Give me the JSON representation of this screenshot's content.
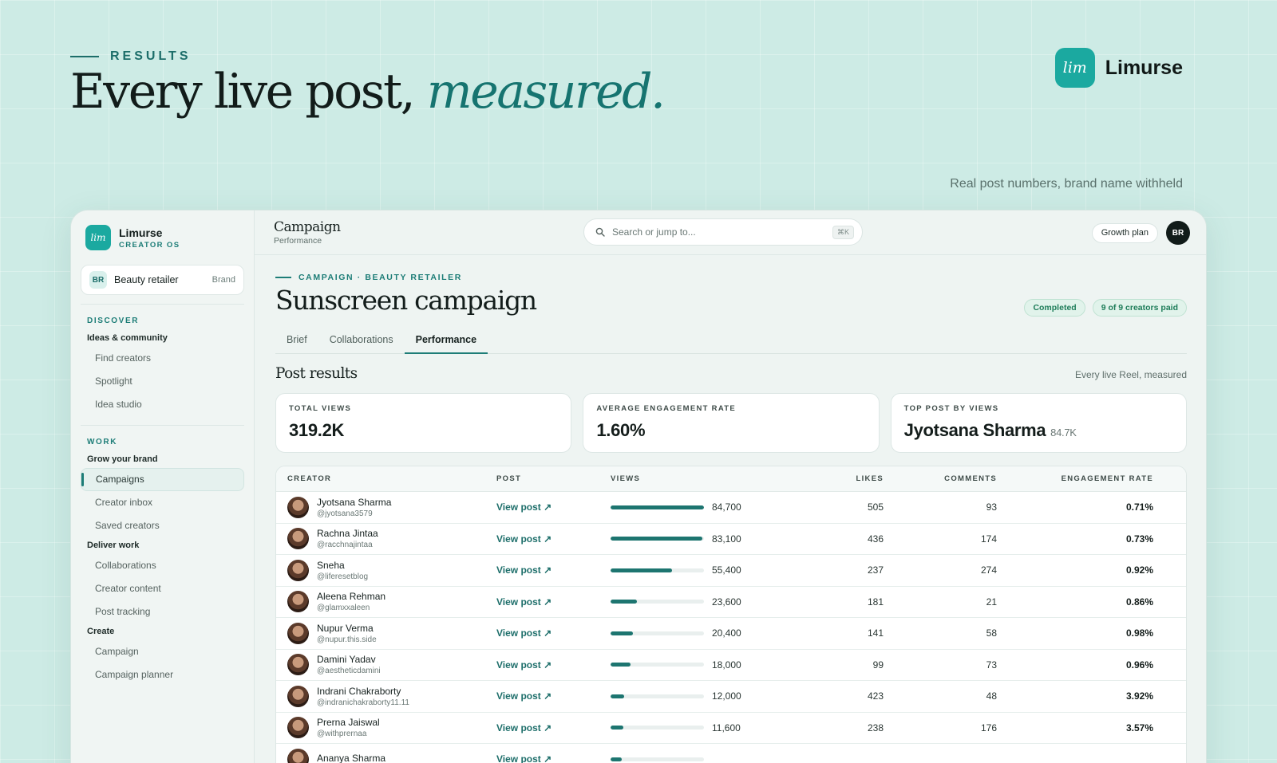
{
  "hero": {
    "eyebrow": "RESULTS",
    "headline_main": "Every live post, ",
    "headline_accent": "measured.",
    "brand_name": "Limurse",
    "logo_text": "lim",
    "caption": "Real post numbers, brand name withheld"
  },
  "colors": {
    "accent": "#1d7570",
    "logo": "#1ba9a0",
    "background": "#cdebe5"
  },
  "sidebar": {
    "brand_name": "Limurse",
    "brand_tag": "CREATOR OS",
    "logo_text": "lim",
    "account": {
      "initials": "BR",
      "name": "Beauty retailer",
      "tag": "Brand"
    },
    "discover_label": "DISCOVER",
    "ideas_group": "Ideas & community",
    "ideas_items": [
      "Find creators",
      "Spotlight",
      "Idea studio"
    ],
    "work_label": "WORK",
    "grow_group": "Grow your brand",
    "grow_items": [
      "Campaigns",
      "Creator inbox",
      "Saved creators"
    ],
    "deliver_group": "Deliver work",
    "deliver_items": [
      "Collaborations",
      "Creator content",
      "Post tracking"
    ],
    "create_group": "Create",
    "create_items": [
      "Campaign",
      "Campaign planner"
    ]
  },
  "topbar": {
    "title": "Campaign",
    "subtitle": "Performance",
    "search_placeholder": "Search or jump to...",
    "shortcut": "⌘K",
    "plan": "Growth plan",
    "user_initials": "BR"
  },
  "campaign": {
    "breadcrumb": "CAMPAIGN · BEAUTY RETAILER",
    "title": "Sunscreen campaign",
    "status": "Completed",
    "paid": "9 of 9 creators paid",
    "tabs": [
      "Brief",
      "Collaborations",
      "Performance"
    ],
    "active_tab": "Performance"
  },
  "results": {
    "title": "Post results",
    "note": "Every live Reel, measured",
    "stats": [
      {
        "label": "TOTAL VIEWS",
        "value": "319.2K",
        "sub": ""
      },
      {
        "label": "AVERAGE ENGAGEMENT RATE",
        "value": "1.60%",
        "sub": ""
      },
      {
        "label": "TOP POST BY VIEWS",
        "value": "Jyotsana Sharma",
        "sub": "84.7K"
      }
    ]
  },
  "table": {
    "columns": [
      "CREATOR",
      "POST",
      "VIEWS",
      "LIKES",
      "COMMENTS",
      "ENGAGEMENT RATE"
    ],
    "link_label": "View post ↗",
    "max_views": 84700,
    "rows": [
      {
        "name": "Jyotsana Sharma",
        "handle": "@jyotsana3579",
        "views": 84700,
        "views_text": "84,700",
        "likes": "505",
        "comments": "93",
        "er": "0.71%"
      },
      {
        "name": "Rachna Jintaa",
        "handle": "@racchnajintaa",
        "views": 83100,
        "views_text": "83,100",
        "likes": "436",
        "comments": "174",
        "er": "0.73%"
      },
      {
        "name": "Sneha",
        "handle": "@liferesetblog",
        "views": 55400,
        "views_text": "55,400",
        "likes": "237",
        "comments": "274",
        "er": "0.92%"
      },
      {
        "name": "Aleena Rehman",
        "handle": "@glamxxaleen",
        "views": 23600,
        "views_text": "23,600",
        "likes": "181",
        "comments": "21",
        "er": "0.86%"
      },
      {
        "name": "Nupur Verma",
        "handle": "@nupur.this.side",
        "views": 20400,
        "views_text": "20,400",
        "likes": "141",
        "comments": "58",
        "er": "0.98%"
      },
      {
        "name": "Damini Yadav",
        "handle": "@aestheticdamini",
        "views": 18000,
        "views_text": "18,000",
        "likes": "99",
        "comments": "73",
        "er": "0.96%"
      },
      {
        "name": "Indrani Chakraborty",
        "handle": "@indranichakraborty11.11",
        "views": 12000,
        "views_text": "12,000",
        "likes": "423",
        "comments": "48",
        "er": "3.92%"
      },
      {
        "name": "Prerna Jaiswal",
        "handle": "@withprernaa",
        "views": 11600,
        "views_text": "11,600",
        "likes": "238",
        "comments": "176",
        "er": "3.57%"
      },
      {
        "name": "Ananya Sharma",
        "handle": "",
        "views": 10400,
        "views_text": "",
        "likes": "",
        "comments": "",
        "er": ""
      }
    ]
  }
}
